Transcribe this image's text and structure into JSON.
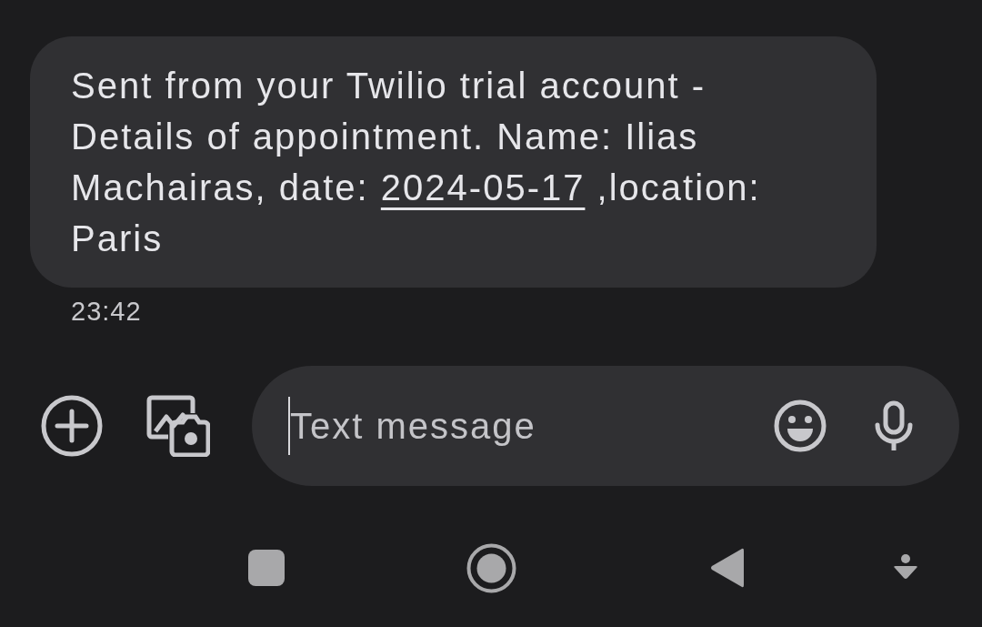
{
  "message": {
    "parts": [
      {
        "kind": "text",
        "text": "Sent from your Twilio trial account - Details of appointment. Name: Ilias Machairas, date: "
      },
      {
        "kind": "link",
        "text": "2024-05-17"
      },
      {
        "kind": "text",
        "text": " ,location: Paris"
      }
    ],
    "time": "23:42"
  },
  "composer": {
    "placeholder": "Text message",
    "focused": true
  }
}
